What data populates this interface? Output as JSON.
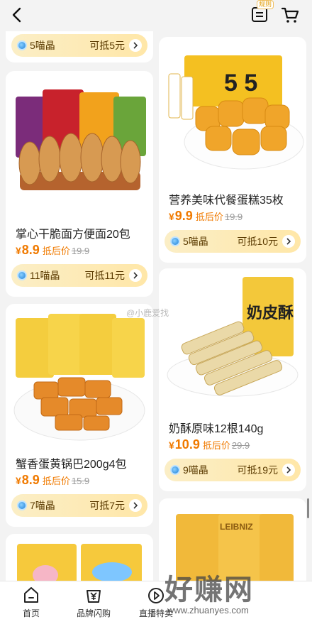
{
  "header": {
    "rules_tag": "规则",
    "back_icon": "back-arrow-icon",
    "rules_icon": "rules-list-icon",
    "cart_icon": "cart-icon"
  },
  "products": [
    {
      "coin_label": "5喵晶",
      "deduct_label": "可抵5元"
    },
    {
      "name": "掌心干脆面方便面20包",
      "price": "8.9",
      "after_label": "抵后价",
      "original": "19.9",
      "coin_label": "11喵晶",
      "deduct_label": "可抵11元"
    },
    {
      "name": "蟹香蛋黄锅巴200g4包",
      "price": "8.9",
      "after_label": "抵后价",
      "original": "15.9",
      "coin_label": "7喵晶",
      "deduct_label": "可抵7元"
    },
    {
      "name": "营养美味代餐蛋糕35枚",
      "price": "9.9",
      "after_label": "抵后价",
      "original": "19.9",
      "coin_label": "5喵晶",
      "deduct_label": "可抵10元"
    },
    {
      "name": "奶酥原味12根140g",
      "price": "10.9",
      "after_label": "抵后价",
      "original": "29.9",
      "coin_label": "9喵晶",
      "deduct_label": "可抵19元"
    }
  ],
  "currency": "¥",
  "package_text": {
    "cake_box": "5 5",
    "biscuit_box": "奶皮酥",
    "leibniz": "LEIBNIZ"
  },
  "watermark": "@小鹿爱找",
  "brand_watermark": {
    "title": "好赚网",
    "url": "www.zhuanyes.com"
  },
  "tabbar": [
    {
      "label": "首页",
      "icon": "home-icon"
    },
    {
      "label": "品牌闪购",
      "icon": "yen-bag-icon"
    },
    {
      "label": "直播特卖",
      "icon": "live-play-icon"
    },
    {
      "label": "",
      "icon": "hidden-icon"
    },
    {
      "label": "",
      "icon": "hidden-icon"
    }
  ],
  "colors": {
    "accent": "#f07a00",
    "coin_bar": "#ffe7a8",
    "background": "#f3f3f3"
  }
}
